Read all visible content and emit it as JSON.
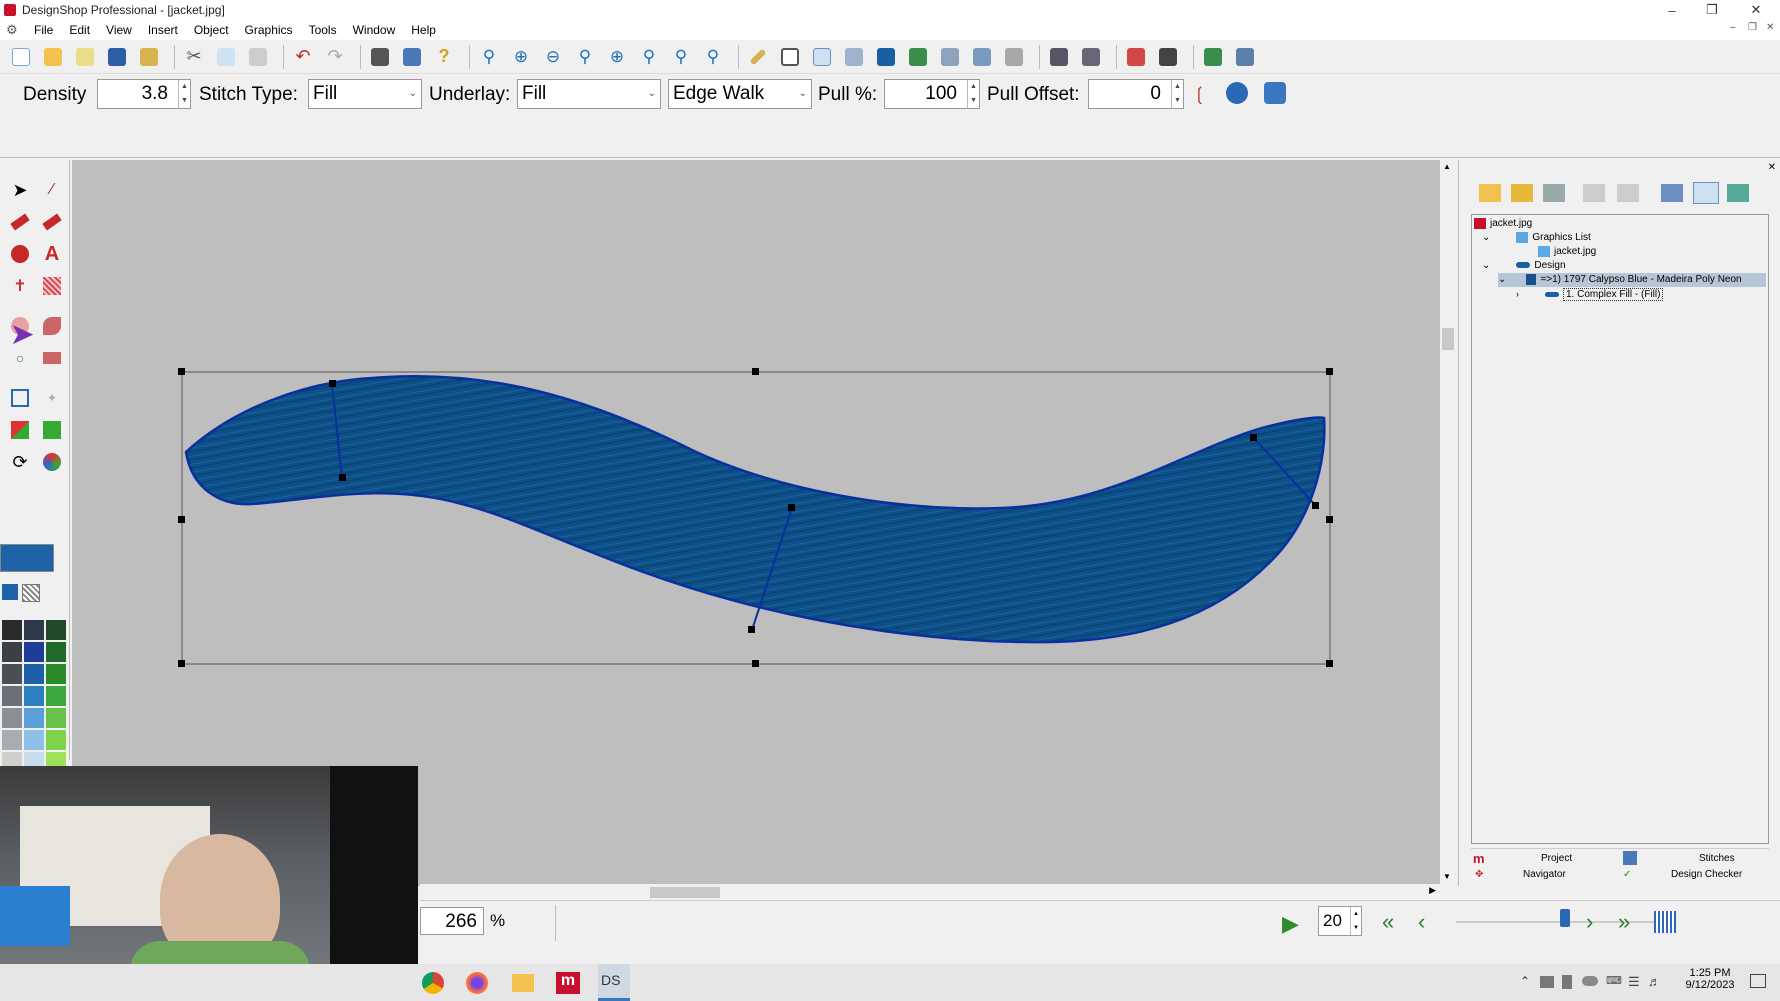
{
  "window": {
    "title": "DesignShop Professional - [jacket.jpg]"
  },
  "menu": [
    "File",
    "Edit",
    "View",
    "Insert",
    "Object",
    "Graphics",
    "Tools",
    "Window",
    "Help"
  ],
  "props": {
    "density_label": "Density",
    "density_value": "3.8",
    "stitch_type_label": "Stitch Type:",
    "stitch_type_value": "Fill",
    "underlay_label": "Underlay:",
    "underlay_value": "Fill",
    "edge_value": "Edge Walk",
    "pull_label": "Pull %:",
    "pull_value": "100",
    "pull_offset_label": "Pull Offset:",
    "pull_offset_value": "0"
  },
  "tree": {
    "root": "jacket.jpg",
    "graphics_list": "Graphics List",
    "graphics_item": "jacket.jpg",
    "design": "Design",
    "color_item": "=>1) 1797 Calypso Blue - Madeira Poly Neon",
    "object_item": "1. Complex Fill - (Fill)"
  },
  "panel_tabs": {
    "project": "Project",
    "stitches": "Stitches",
    "navigator": "Navigator",
    "design_checker": "Design Checker"
  },
  "status": {
    "zoom": "266",
    "zoom_unit": "%",
    "step": "20"
  },
  "taskbar": {
    "time": "1:25 PM",
    "date": "9/12/2023"
  },
  "colors": {
    "stitch_fill": "#0d4f86",
    "stitch_edge": "#0a2f9e",
    "canvas": "#bebebe"
  }
}
